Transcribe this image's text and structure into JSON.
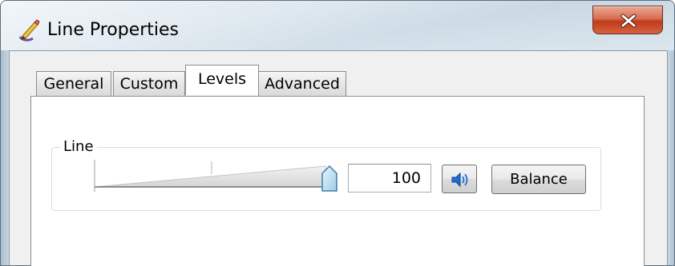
{
  "window": {
    "title": "Line Properties",
    "app_icon": "pencil-brush-icon",
    "close_icon": "close-icon",
    "close_color": "#c8381a"
  },
  "tabs": [
    {
      "label": "General",
      "active": false
    },
    {
      "label": "Custom",
      "active": false
    },
    {
      "label": "Levels",
      "active": true
    },
    {
      "label": "Advanced",
      "active": false
    }
  ],
  "levels": {
    "group_label": "Line",
    "slider_value_fraction": 1.0,
    "value": "100",
    "speaker_icon": "speaker-icon",
    "speaker_color": "#1f6fd1",
    "balance_label": "Balance"
  }
}
